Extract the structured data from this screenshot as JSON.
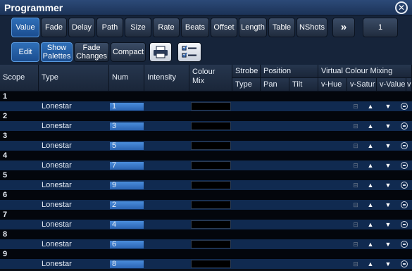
{
  "window": {
    "title": "Programmer"
  },
  "toolbar1": {
    "buttons": [
      {
        "label": "Value",
        "active": true
      },
      {
        "label": "Fade"
      },
      {
        "label": "Delay"
      },
      {
        "label": "Path"
      },
      {
        "label": "Size"
      },
      {
        "label": "Rate"
      },
      {
        "label": "Beats"
      },
      {
        "label": "Offset"
      },
      {
        "label": "Length"
      },
      {
        "label": "Table"
      },
      {
        "label": "NShots"
      }
    ],
    "more_label": "»",
    "page_value": "1"
  },
  "toolbar2": {
    "edit_label": "Edit",
    "show_palettes_label": "Show Palettes",
    "fade_changes_label": "Fade Changes",
    "compact_label": "Compact"
  },
  "headers": {
    "scope": "Scope",
    "type": "Type",
    "num": "Num",
    "intensity": "Intensity",
    "colour_mix": "Colour Mix",
    "strobe": "Strobe",
    "position": "Position",
    "virtual_colour_mixing": "Virtual Colour Mixing",
    "strobe_type": "Type",
    "pan": "Pan",
    "tilt": "Tilt",
    "v_hue": "v-Hue",
    "v_satur": "v-Satur",
    "v_value": "v-Value",
    "v_more": "v"
  },
  "rows": [
    {
      "scope": "1",
      "type": "Lonestar",
      "num": "1"
    },
    {
      "scope": "2",
      "type": "Lonestar",
      "num": "3"
    },
    {
      "scope": "3",
      "type": "Lonestar",
      "num": "5"
    },
    {
      "scope": "4",
      "type": "Lonestar",
      "num": "7"
    },
    {
      "scope": "5",
      "type": "Lonestar",
      "num": "9"
    },
    {
      "scope": "6",
      "type": "Lonestar",
      "num": "2"
    },
    {
      "scope": "7",
      "type": "Lonestar",
      "num": "4"
    },
    {
      "scope": "8",
      "type": "Lonestar",
      "num": "6"
    },
    {
      "scope": "9",
      "type": "Lonestar",
      "num": "8"
    }
  ],
  "icons": {
    "close": "close-icon",
    "more": "double-chevron-right-icon",
    "print": "printer-icon",
    "checklist": "checklist-icon"
  }
}
